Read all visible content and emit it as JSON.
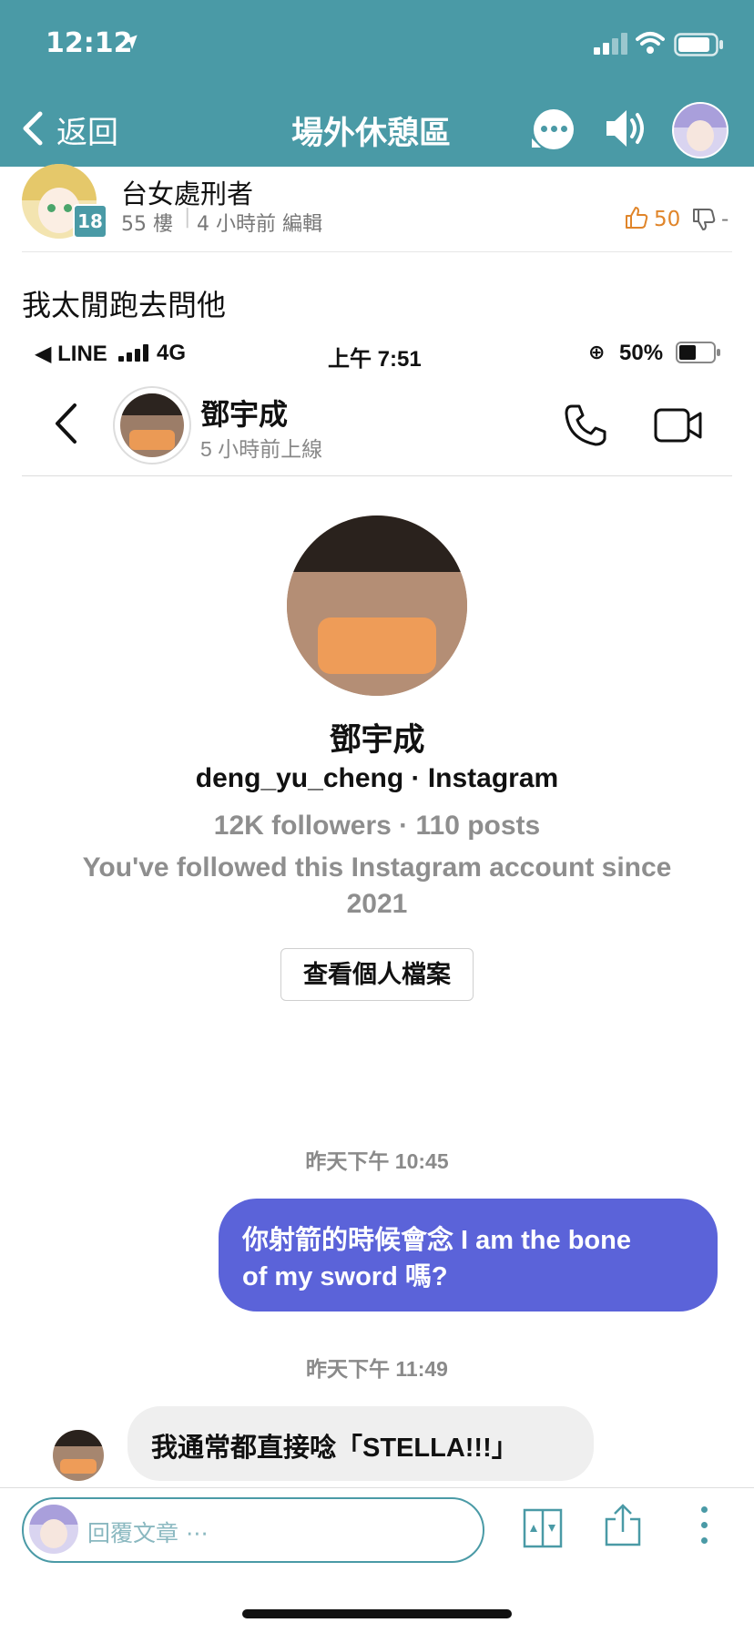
{
  "status_bar": {
    "time": "12:12",
    "location_glyph": "➤"
  },
  "header": {
    "back_label": "返回",
    "title": "場外休憩區"
  },
  "post": {
    "author": "台女處刑者",
    "level_badge": "18",
    "floor": "55 樓",
    "separator": "|",
    "time_info": "4 小時前 編輯",
    "like_count": "50",
    "dislike_count": "-",
    "body_text": "我太閒跑去問他"
  },
  "embedded": {
    "status": {
      "carrier": "◀ LINE",
      "network": "4G",
      "time": "上午 7:51",
      "battery": "50%"
    },
    "chat_header": {
      "name": "鄧宇成",
      "last_seen": "5 小時前上線"
    },
    "profile": {
      "name": "鄧宇成",
      "handle": "deng_yu_cheng · Instagram",
      "stats": "12K followers · 110 posts",
      "follow_note_1": "You've followed this Instagram account since",
      "follow_note_2": "2021",
      "view_profile_label": "查看個人檔案"
    },
    "messages": [
      {
        "timestamp": "昨天下午 10:45",
        "direction": "out",
        "line1": "你射箭的時候會念 I am the bone",
        "line2": "of my sword 嗎?"
      },
      {
        "timestamp": "昨天下午 11:49",
        "direction": "in",
        "text": "我通常都直接唸「STELLA!!!」"
      }
    ]
  },
  "reply": {
    "placeholder": "回覆文章 ⋯"
  },
  "colors": {
    "header_teal": "#4a9aa6",
    "outgoing_bubble": "#5b63d9",
    "like_orange": "#e0852a"
  },
  "icons": [
    "navigation-arrow-icon",
    "signal-icon",
    "wifi-icon",
    "battery-icon",
    "back-chevron-icon",
    "chat-bubble-icon",
    "speaker-icon",
    "phone-icon",
    "video-icon",
    "thumbs-up-icon",
    "thumbs-down-icon",
    "page-flip-icon",
    "share-icon",
    "more-vertical-icon"
  ]
}
